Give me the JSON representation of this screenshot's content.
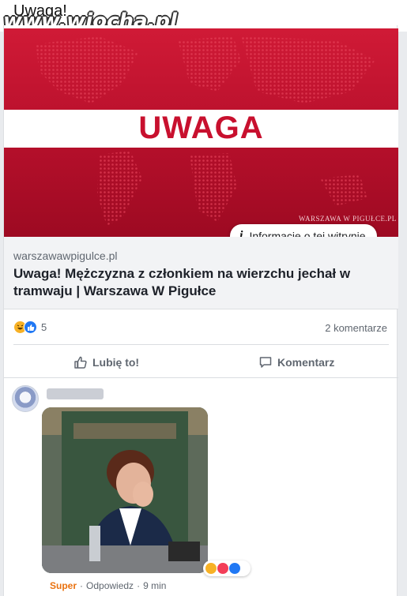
{
  "caption": {
    "title": "Uwaga!",
    "watermark": "www.wiocha.pl"
  },
  "hero": {
    "headline": "UWAGA",
    "logo_text": "WARSZAWA W PIGUŁCE.PL",
    "brand_red": "#c8102e"
  },
  "info_pill": {
    "icon": "info-icon",
    "label": "Informacje o tej witrynie"
  },
  "link": {
    "domain": "warszawawpigulce.pl",
    "title": "Uwaga! Mężczyzna z członkiem na wierzchu jechał w tramwaju | Warszawa W Pigułce"
  },
  "stats": {
    "reaction_icons": [
      "haha-icon",
      "like-icon"
    ],
    "reaction_count": "5",
    "comments": "2 komentarze"
  },
  "actions": {
    "like": "Lubię to!",
    "comment": "Komentarz"
  },
  "comment": {
    "reaction_label": "Super",
    "reply_label": "Odpowiedz",
    "separator": "·",
    "time": "9 min"
  }
}
